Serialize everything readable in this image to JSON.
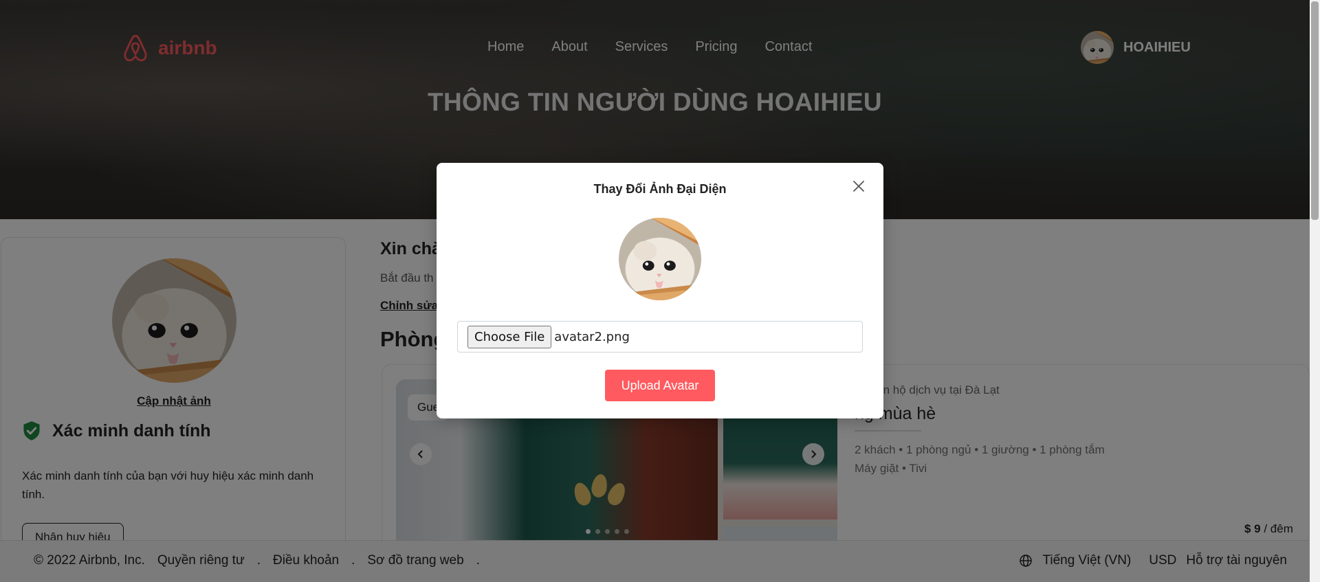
{
  "header": {
    "brand": "airbnb",
    "nav": [
      "Home",
      "About",
      "Services",
      "Pricing",
      "Contact"
    ],
    "user_name": "HOAIHIEU",
    "hero_title": "THÔNG TIN NGƯỜI DÙNG HOAIHIEU"
  },
  "profile_card": {
    "update_photo": "Cập nhật ảnh",
    "verify_title": "Xác minh danh tính",
    "verify_desc": "Xác minh danh tính của bạn với huy hiệu xác minh danh tính.",
    "badge_button": "Nhận huy hiệu"
  },
  "main": {
    "greeting": "Xin chà",
    "subtext": "Bắt đầu th",
    "edit_link": "Chỉnh sửa",
    "rooms_title": "Phòng"
  },
  "room": {
    "guest_chip": "Gue",
    "subtitle": "bộ căn hộ dịch vụ tại Đà Lạt",
    "name": "ng mùa hè",
    "specs": "2 khách • 1 phòng ngủ • 1 giường • 1 phòng tắm",
    "amenities": "Máy giặt • Tivi",
    "price": "$ 9",
    "price_unit": " / đêm"
  },
  "footer": {
    "copyright": "© 2022 Airbnb, Inc.",
    "links": [
      "Quyền riêng tư",
      ".",
      "Điều khoản",
      ".",
      "Sơ đồ trang web",
      "."
    ],
    "language": "Tiếng Việt (VN)",
    "currency": "USD",
    "support": "Hỗ trợ tài nguyên"
  },
  "modal": {
    "title": "Thay Đổi Ảnh Đại Diện",
    "choose_file": "Choose File",
    "file_name": "avatar2.png",
    "upload_button": "Upload Avatar"
  },
  "colors": {
    "brand": "#ff5a5f",
    "verify_green": "#1e8a3e"
  },
  "icons": {
    "logo": "airbnb-logo-icon",
    "verify": "shield-check-icon",
    "close": "close-icon",
    "globe": "globe-icon",
    "prev": "chevron-left-icon",
    "next": "chevron-right-icon"
  }
}
